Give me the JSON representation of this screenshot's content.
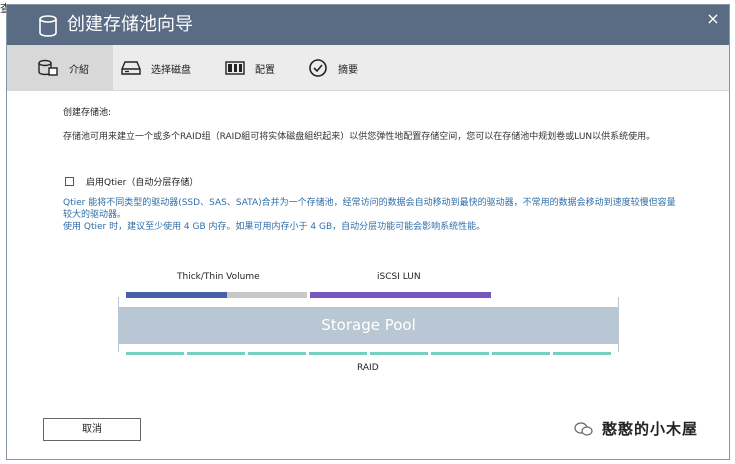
{
  "corner_text": "查",
  "dialog": {
    "title": "创建存储池向导",
    "close_symbol": "×"
  },
  "steps": [
    {
      "label": "介紹",
      "icon": "intro-icon",
      "active": true
    },
    {
      "label": "选择磁盘",
      "icon": "disk-icon",
      "active": false
    },
    {
      "label": "配置",
      "icon": "config-icon",
      "active": false
    },
    {
      "label": "摘要",
      "icon": "summary-check-icon",
      "active": false
    }
  ],
  "content": {
    "heading": "创建存储池:",
    "description": "存储池可用来建立一个或多个RAID组（RAID組可将实体磁盘組织起来）以供您弹性地配置存储空间，您可以在存储池中规划卷或LUN以供系统使用。",
    "qtier_label": "启用Qtier（自动分层存储）",
    "qtier_checked": false,
    "qtier_info_line1": "Qtier 能将不同类型的驱动器(SSD、SAS、SATA)合并为一个存储池，经常访问的数据会自动移动到最快的驱动器，不常用的数据会移动到速度较慢但容量较大的驱动器。",
    "qtier_info_line2": "使用 Qtier 时，建议至少使用 4 GB 内存。如果可用内存小于 4 GB，自动分层功能可能会影响系统性能。"
  },
  "diagram": {
    "volume_label": "Thick/Thin Volume",
    "lun_label": "iSCSI LUN",
    "pool_label": "Storage Pool",
    "raid_label": "RAID",
    "colors": {
      "volume_used": "#4a5eaa",
      "volume_free": "#c8c8c8",
      "lun": "#7658c0",
      "pool": "#b9c7d4",
      "raid": "#74d1bf"
    }
  },
  "footer": {
    "cancel_label": "取消"
  },
  "watermark": {
    "text": "憨憨的小木屋",
    "icon": "wechat-icon"
  }
}
